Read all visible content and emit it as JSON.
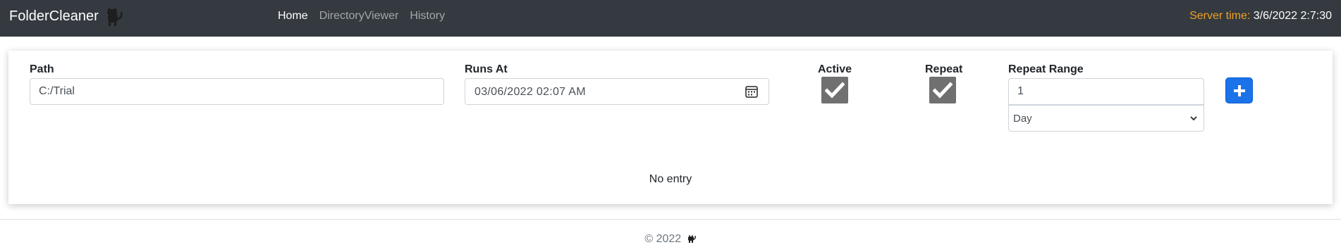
{
  "navbar": {
    "brand": "FolderCleaner",
    "brand_icon": "cat-icon",
    "links": [
      {
        "label": "Home",
        "active": true
      },
      {
        "label": "DirectoryViewer",
        "active": false
      },
      {
        "label": "History",
        "active": false
      }
    ],
    "server_time_label": "Server time:",
    "server_time_value": "3/6/2022 2:7:30"
  },
  "form": {
    "path_label": "Path",
    "path_value": "C:/Trial",
    "runs_at_label": "Runs At",
    "runs_at_value": "03/06/2022 02:07  AM",
    "active_label": "Active",
    "active_checked": true,
    "repeat_label": "Repeat",
    "repeat_checked": true,
    "repeat_range_label": "Repeat Range",
    "repeat_range_value": "1",
    "repeat_unit_value": "Day",
    "add_button_icon": "plus-icon"
  },
  "table": {
    "empty_text": "No entry"
  },
  "footer": {
    "text": "© 2022",
    "icon": "cat-icon"
  },
  "colors": {
    "navbar_bg": "#343a40",
    "server_label": "#f0a020",
    "accent": "#1a73e8",
    "checkbox_bg": "#707070"
  }
}
